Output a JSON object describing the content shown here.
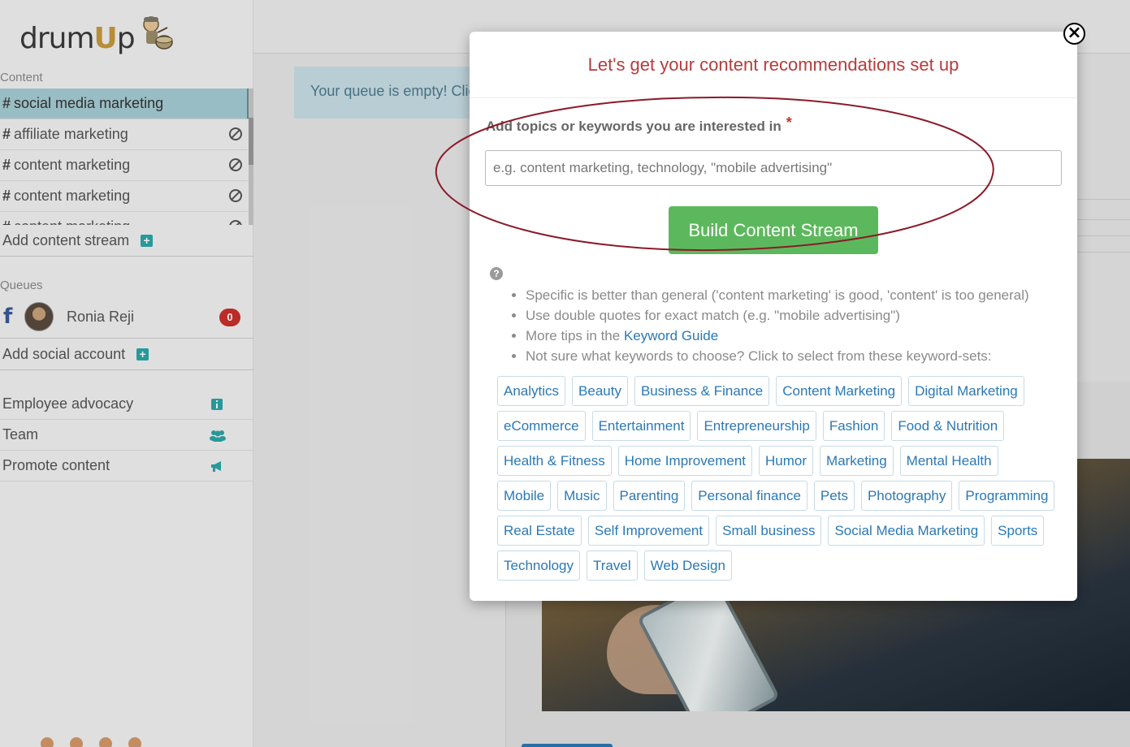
{
  "logo": {
    "text_prefix": "drum",
    "text_u": "U",
    "text_suffix": "p"
  },
  "sidebar": {
    "content_label": "Content",
    "streams": [
      {
        "label": "social media marketing",
        "active": true
      },
      {
        "label": "affiliate marketing",
        "active": false
      },
      {
        "label": "content marketing",
        "active": false
      },
      {
        "label": "content marketing",
        "active": false
      },
      {
        "label": "content marketing",
        "active": false
      }
    ],
    "add_stream_label": "Add content stream",
    "queues_label": "Queues",
    "queue": {
      "name": "Ronia Reji",
      "count": "0"
    },
    "add_social_label": "Add social account",
    "menu": [
      {
        "label": "Employee advocacy",
        "icon": "info-icon"
      },
      {
        "label": "Team",
        "icon": "users-icon"
      },
      {
        "label": "Promote content",
        "icon": "megaphone-icon"
      }
    ]
  },
  "main": {
    "alert_text": "Your queue is empty! Clic"
  },
  "modal": {
    "title": "Let's get your content recommendations set up",
    "close_glyph": "×",
    "field_label": "Add topics or keywords you are interested in",
    "required_mark": "*",
    "input_placeholder": "e.g. content marketing, technology, \"mobile advertising\"",
    "input_value": "",
    "build_button": "Build Content Stream",
    "help_glyph": "?",
    "tips": [
      "Specific is better than general ('content marketing' is good, 'content' is too general)",
      "Use double quotes for exact match (e.g. \"mobile advertising\")",
      "More tips in the ",
      "Not sure what keywords to choose? Click to select from these keyword-sets:"
    ],
    "keyword_guide_link": "Keyword Guide",
    "keyword_sets": [
      "Analytics",
      "Beauty",
      "Business & Finance",
      "Content Marketing",
      "Digital Marketing",
      "eCommerce",
      "Entertainment",
      "Entrepreneurship",
      "Fashion",
      "Food & Nutrition",
      "Health & Fitness",
      "Home Improvement",
      "Humor",
      "Marketing",
      "Mental Health",
      "Mobile",
      "Music",
      "Parenting",
      "Personal finance",
      "Pets",
      "Photography",
      "Programming",
      "Real Estate",
      "Self Improvement",
      "Small business",
      "Social Media Marketing",
      "Sports",
      "Technology",
      "Travel",
      "Web Design"
    ]
  },
  "colors": {
    "brand_teal": "#2ba6a8",
    "title_red": "#b83b3b",
    "button_green": "#5cb85c",
    "link_blue": "#2a78b8",
    "annotation_ellipse": "#8b1a2a"
  }
}
